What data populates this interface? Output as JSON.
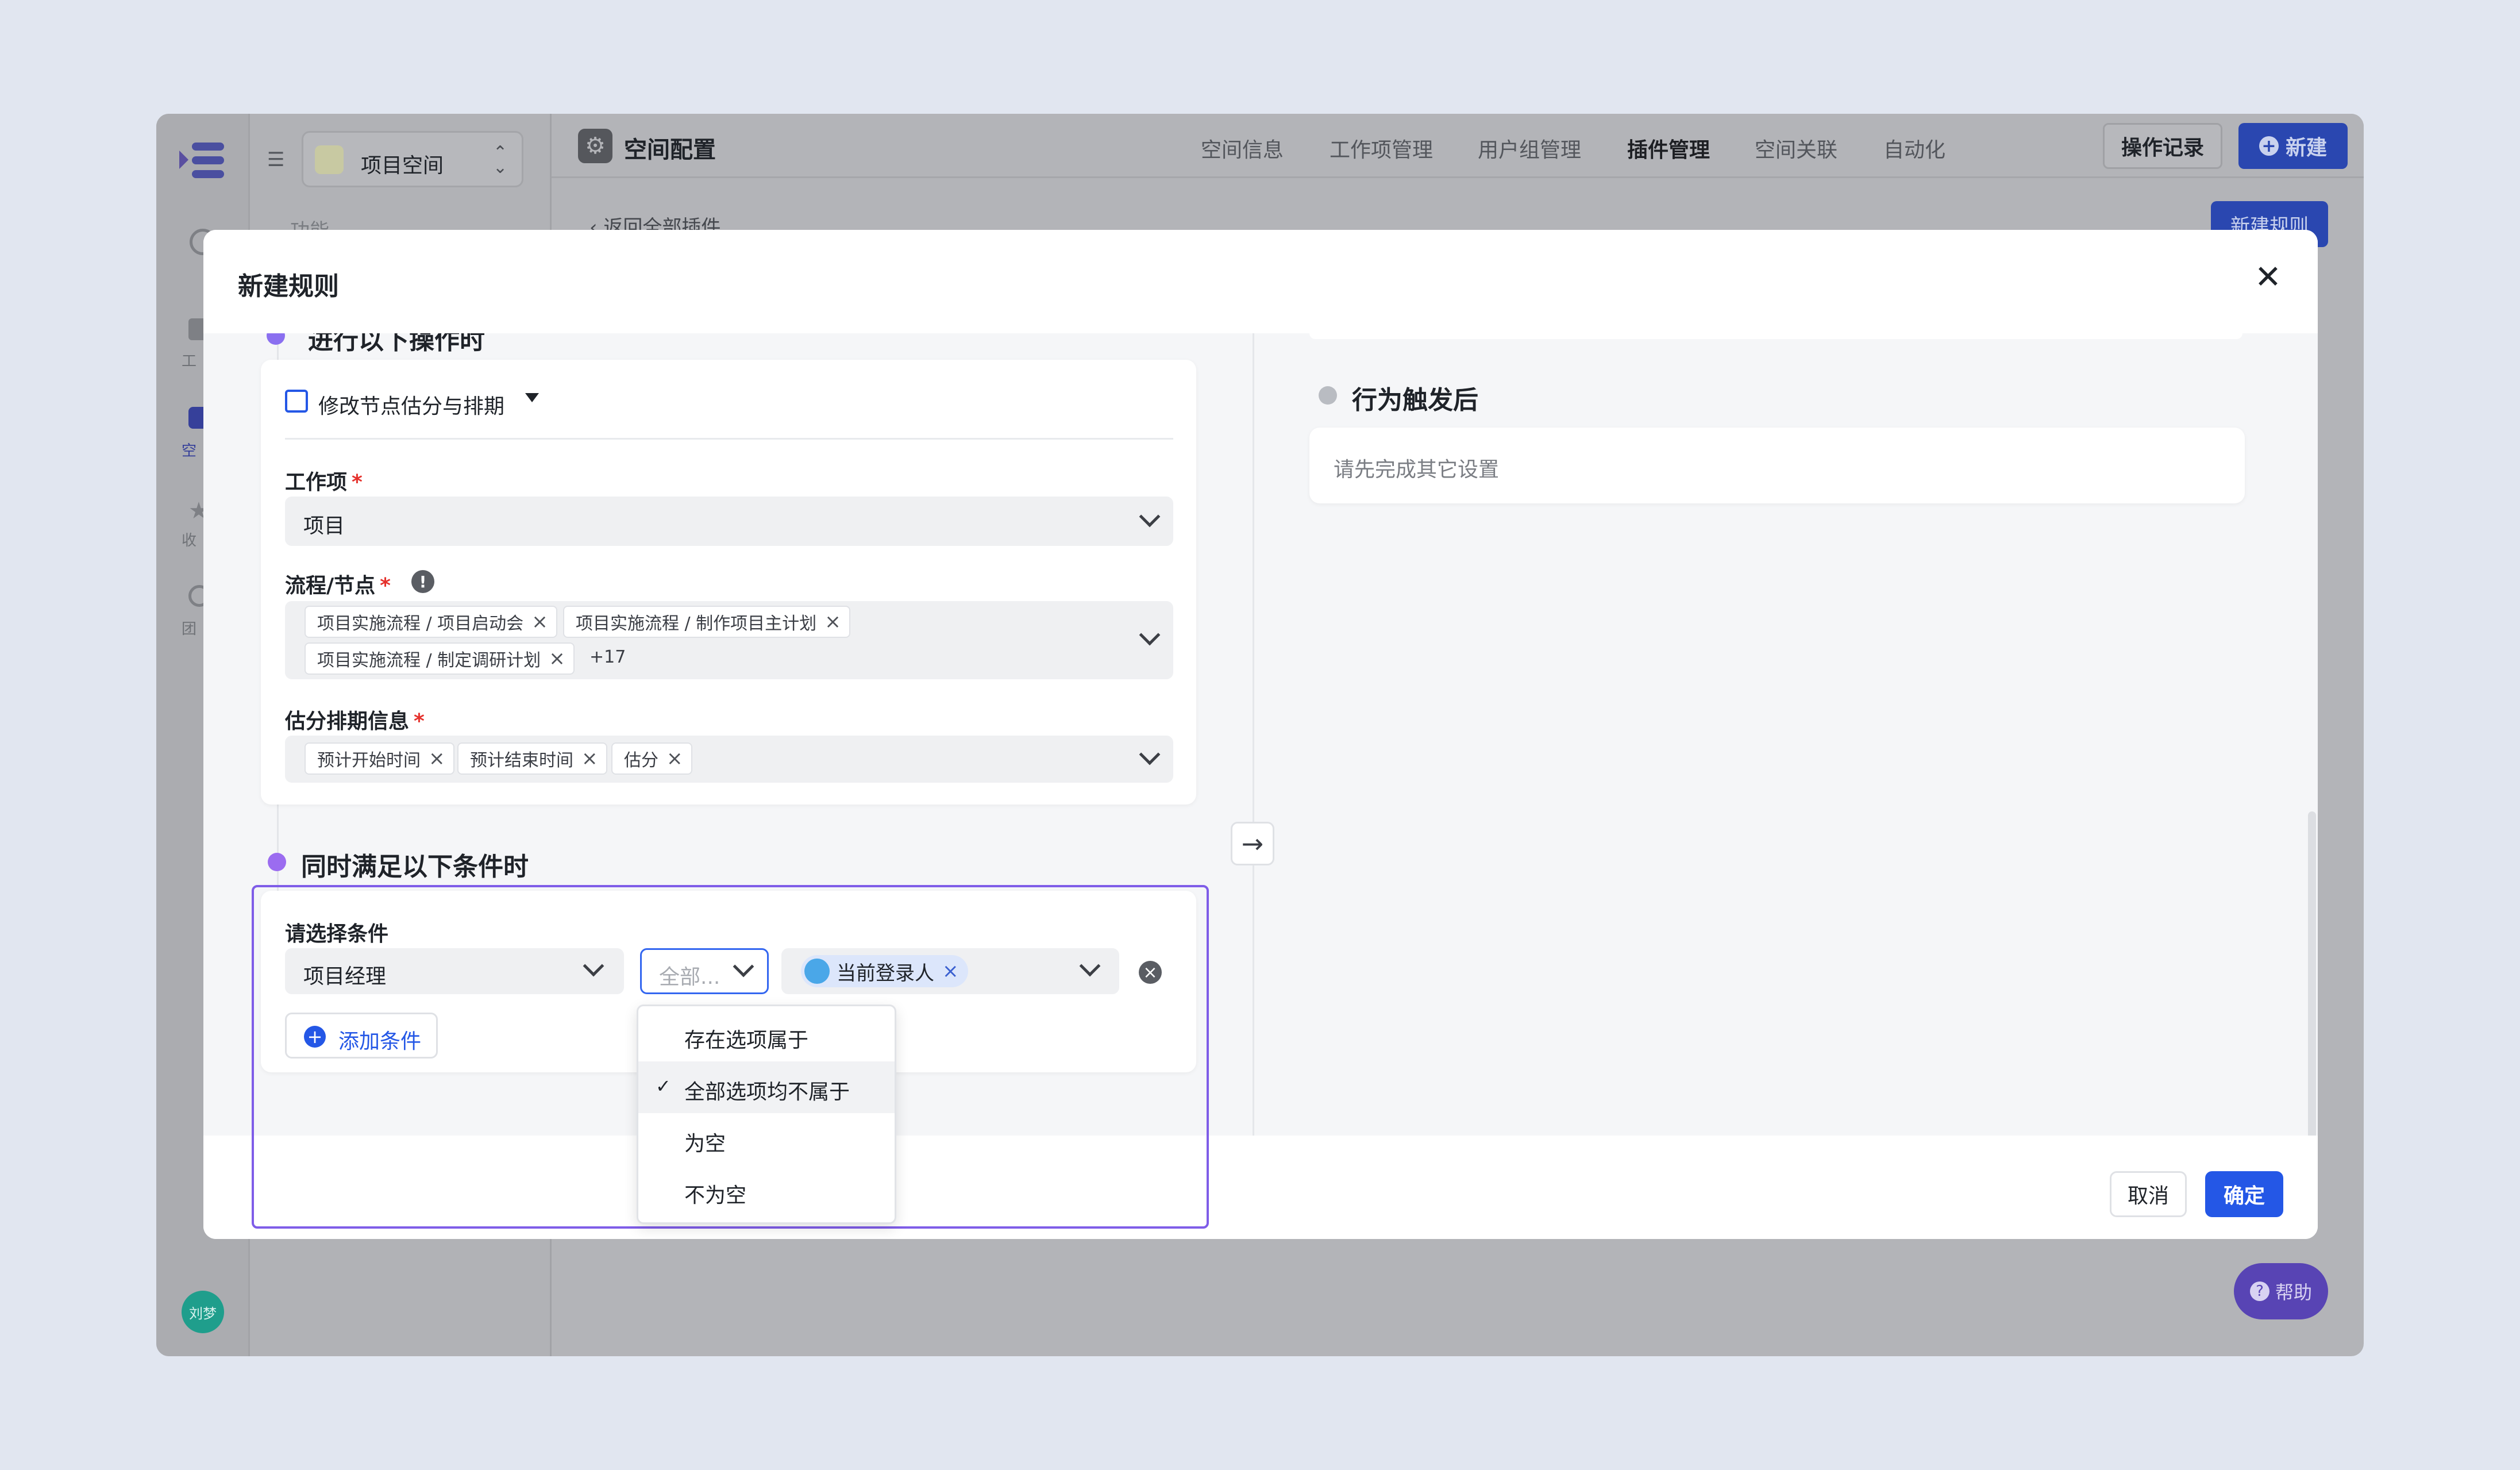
{
  "colors": {
    "accent": "#2457e6",
    "purple": "#9b6cf0",
    "required": "#e5312c",
    "avatar": "#1f9e8c",
    "help": "#7c5ce6"
  },
  "sidebar": {
    "space_name": "项目空间",
    "section_label": "功能",
    "user_avatar": "刘梦",
    "rail_labels": [
      "工",
      "空",
      "收",
      "团"
    ]
  },
  "header": {
    "title": "空间配置",
    "tabs": [
      "空间信息",
      "工作项管理",
      "用户组管理",
      "插件管理",
      "空间关联",
      "自动化"
    ],
    "active_tab": "插件管理",
    "history_button": "操作记录",
    "new_button": "新建"
  },
  "page": {
    "back_link": "返回全部插件",
    "new_rule_button": "新建规则"
  },
  "help_button": "帮助",
  "modal": {
    "title": "新建规则",
    "trigger": {
      "step_title": "进行以下操作时",
      "action": "修改节点估分与排期",
      "workitem_label": "工作项",
      "workitem_value": "项目",
      "flow_label": "流程/节点",
      "flow_tags": [
        "项目实施流程 / 项目启动会",
        "项目实施流程 / 制作项目主计划",
        "项目实施流程 / 制定调研计划"
      ],
      "flow_more": "+17",
      "estimate_label": "估分排期信息",
      "estimate_tags": [
        "预计开始时间",
        "预计结束时间",
        "估分"
      ]
    },
    "condition": {
      "step_title": "同时满足以下条件时",
      "label": "请选择条件",
      "field_value": "项目经理",
      "operator_placeholder": "全部...",
      "user_tag": "当前登录人",
      "add_button": "添加条件",
      "operator_options": [
        "存在选项属于",
        "全部选项均不属于",
        "为空",
        "不为空"
      ],
      "selected_option": "全部选项均不属于"
    },
    "after": {
      "step_title": "行为触发后",
      "placeholder": "请先完成其它设置"
    },
    "cancel_button": "取消",
    "confirm_button": "确定"
  }
}
